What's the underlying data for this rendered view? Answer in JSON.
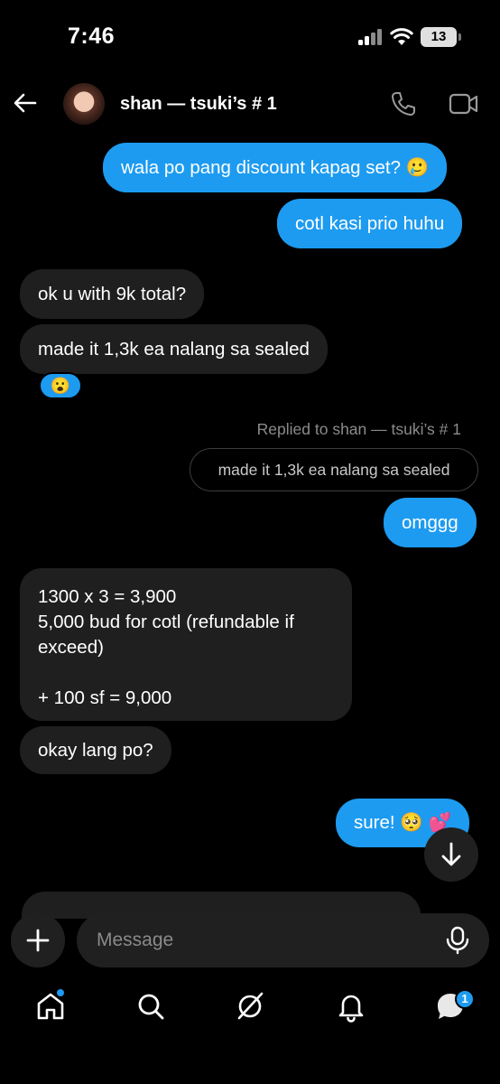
{
  "status": {
    "time": "7:46",
    "battery": "13"
  },
  "header": {
    "contact_name": "shan — tsuki’s # 1"
  },
  "messages": [
    {
      "text": "wala po pang discount kapag set? 🥲"
    },
    {
      "text": "cotl kasi prio huhu"
    },
    {
      "text": "ok u with 9k total?"
    },
    {
      "text": "made it 1,3k ea nalang sa sealed"
    },
    {
      "text": "😮"
    },
    {
      "text": "Replied to shan — tsuki’s # 1"
    },
    {
      "text": "made it 1,3k ea nalang sa sealed"
    },
    {
      "text": "omggg"
    },
    {
      "text": "1300 x 3 = 3,900\n5,000 bud for cotl (refundable if\nexceed)\n\n+ 100 sf = 9,000"
    },
    {
      "text": "okay lang po?"
    },
    {
      "text": "sure! 🥺 💕"
    }
  ],
  "composer": {
    "placeholder": "Message"
  },
  "nav": {
    "messages_badge": "1"
  },
  "colors": {
    "accent": "#1d9bf0",
    "bubble_incoming": "#1f1f1f",
    "background": "#000000"
  }
}
